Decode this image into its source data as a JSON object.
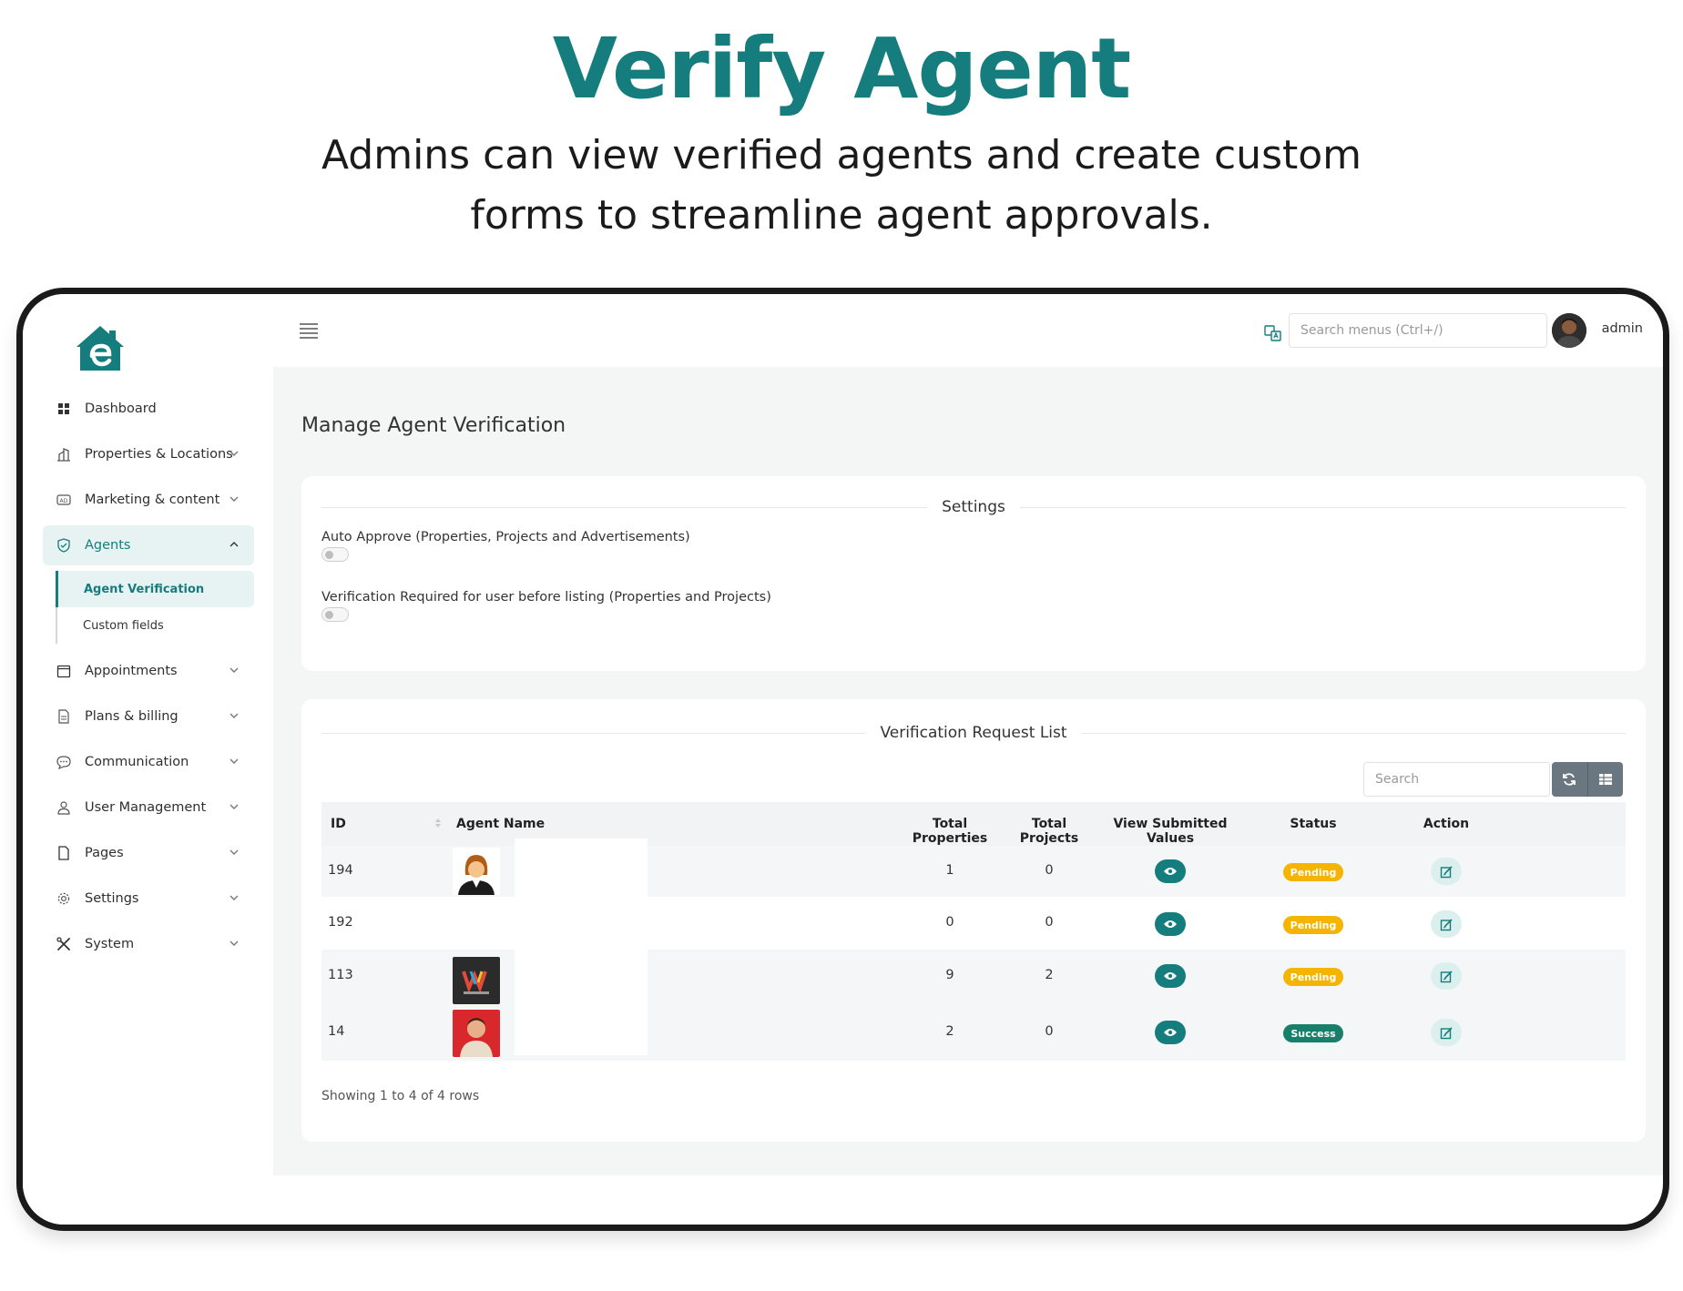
{
  "promo": {
    "title": "Verify Agent",
    "subtitle": "Admins can view verified agents and create custom forms to streamline agent approvals."
  },
  "brand": {
    "accent": "#157d7d",
    "pending": "#f5b400",
    "success": "#17806a"
  },
  "sidebar": {
    "items": [
      {
        "label": "Dashboard",
        "icon": "grid-icon",
        "chevron": false
      },
      {
        "label": "Properties & Locations",
        "icon": "building-icon",
        "chevron": true
      },
      {
        "label": "Marketing & content",
        "icon": "ad-icon",
        "chevron": true
      },
      {
        "label": "Agents",
        "icon": "shield-icon",
        "chevron": true,
        "active": true
      },
      {
        "label": "Appointments",
        "icon": "calendar-icon",
        "chevron": true
      },
      {
        "label": "Plans & billing",
        "icon": "receipt-icon",
        "chevron": true
      },
      {
        "label": "Communication",
        "icon": "chat-icon",
        "chevron": true
      },
      {
        "label": "User Management",
        "icon": "user-icon",
        "chevron": true
      },
      {
        "label": "Pages",
        "icon": "page-icon",
        "chevron": true
      },
      {
        "label": "Settings",
        "icon": "gear-icon",
        "chevron": true
      },
      {
        "label": "System",
        "icon": "tools-icon",
        "chevron": true
      }
    ],
    "agents_submenu": [
      {
        "label": "Agent Verification",
        "active": true
      },
      {
        "label": "Custom fields"
      }
    ]
  },
  "topbar": {
    "search_placeholder": "Search menus (Ctrl+/)",
    "user_name": "admin"
  },
  "page": {
    "title": "Manage Agent Verification",
    "settings": {
      "heading": "Settings",
      "options": [
        {
          "label": "Auto Approve (Properties, Projects and Advertisements)",
          "enabled": false
        },
        {
          "label": "Verification Required for user before listing (Properties and Projects)",
          "enabled": false
        }
      ]
    },
    "list": {
      "heading": "Verification Request List",
      "search_placeholder": "Search",
      "columns": [
        "ID",
        "Agent Name",
        "Total Properties",
        "Total Projects",
        "View Submitted Values",
        "Status",
        "Action"
      ],
      "rows": [
        {
          "id": "194",
          "avatar": "woman-avatar",
          "total_properties": "1",
          "total_projects": "0",
          "status": "Pending"
        },
        {
          "id": "192",
          "avatar": "",
          "total_properties": "0",
          "total_projects": "0",
          "status": "Pending"
        },
        {
          "id": "113",
          "avatar": "logo-avatar",
          "total_properties": "9",
          "total_projects": "2",
          "status": "Pending"
        },
        {
          "id": "14",
          "avatar": "man-photo",
          "total_properties": "2",
          "total_projects": "0",
          "status": "Success"
        }
      ],
      "footer": "Showing 1 to 4 of 4 rows"
    }
  }
}
